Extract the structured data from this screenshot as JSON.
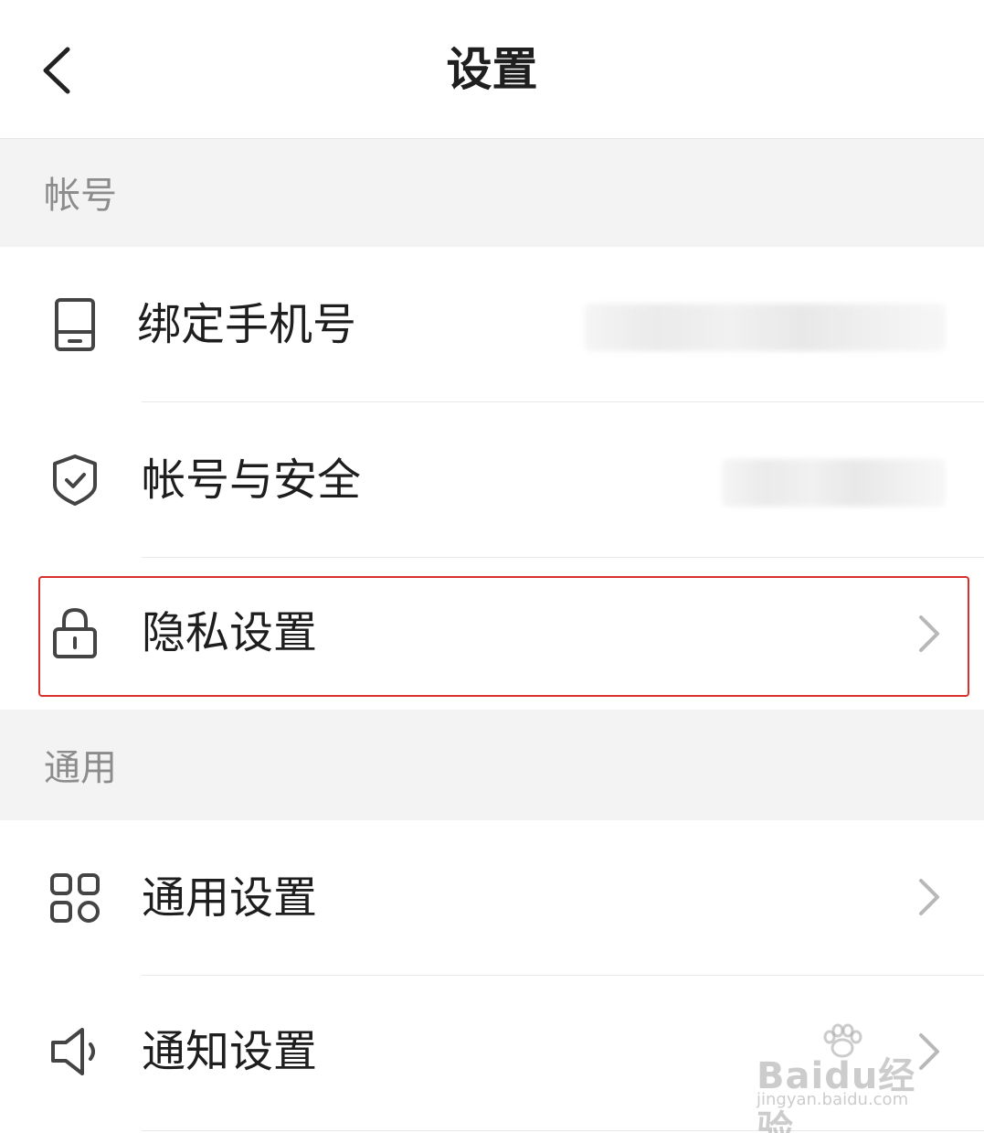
{
  "header": {
    "title": "设置",
    "back_icon": "chevron-left-icon"
  },
  "sections": {
    "account": {
      "label": "帐号",
      "items": {
        "bind_phone": {
          "label": "绑定手机号",
          "icon": "phone-icon",
          "value_obscured": true
        },
        "account_security": {
          "label": "帐号与安全",
          "icon": "shield-check-icon",
          "value_obscured": true
        },
        "privacy": {
          "label": "隐私设置",
          "icon": "lock-icon",
          "highlighted": true
        }
      }
    },
    "general": {
      "label": "通用",
      "items": {
        "general_settings": {
          "label": "通用设置",
          "icon": "grid-icon"
        },
        "notification_settings": {
          "label": "通知设置",
          "icon": "speaker-icon"
        }
      }
    }
  },
  "colors": {
    "highlight_border": "#d8302a",
    "section_bg": "#f3f3f3",
    "text_primary": "#1e1e1e",
    "text_secondary": "#8c8c8c"
  },
  "watermark": {
    "text": "Baidu经验",
    "url_text": "jingyan.baidu.com"
  }
}
